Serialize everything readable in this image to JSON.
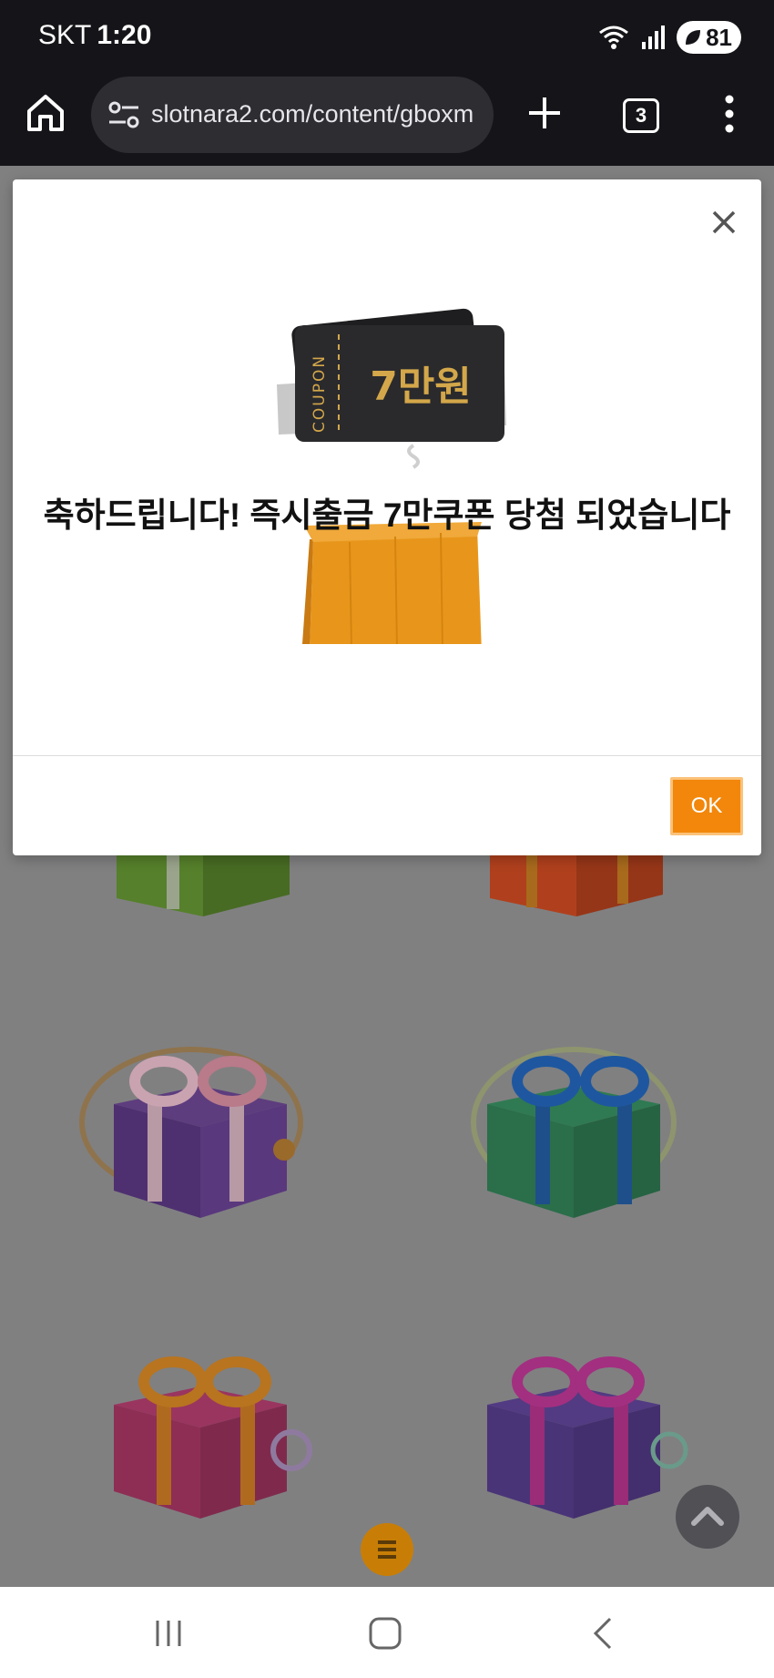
{
  "status_bar": {
    "carrier": "SKT",
    "time": "1:20",
    "battery": "81"
  },
  "browser": {
    "url": "slotnara2.com/content/gboxm",
    "tab_count": "3"
  },
  "dialog": {
    "message": "축하드립니다! 즉시출금 7만쿠폰 당첨 되었습니다",
    "coupon_vertical_label": "COUPON",
    "coupon_amount": "7만원",
    "ok_label": "OK"
  },
  "colors": {
    "accent": "#f2870b",
    "toolbar": "#151519",
    "overlay": "#808081"
  },
  "gifts": [
    {
      "name": "gift-green",
      "color": "#5a8a2c"
    },
    {
      "name": "gift-red",
      "color": "#b8431f"
    },
    {
      "name": "gift-purple",
      "color": "#4e3070"
    },
    {
      "name": "gift-teal",
      "color": "#2a6e4a"
    },
    {
      "name": "gift-pink",
      "color": "#8e2e55"
    },
    {
      "name": "gift-violet",
      "color": "#4a3478"
    }
  ]
}
